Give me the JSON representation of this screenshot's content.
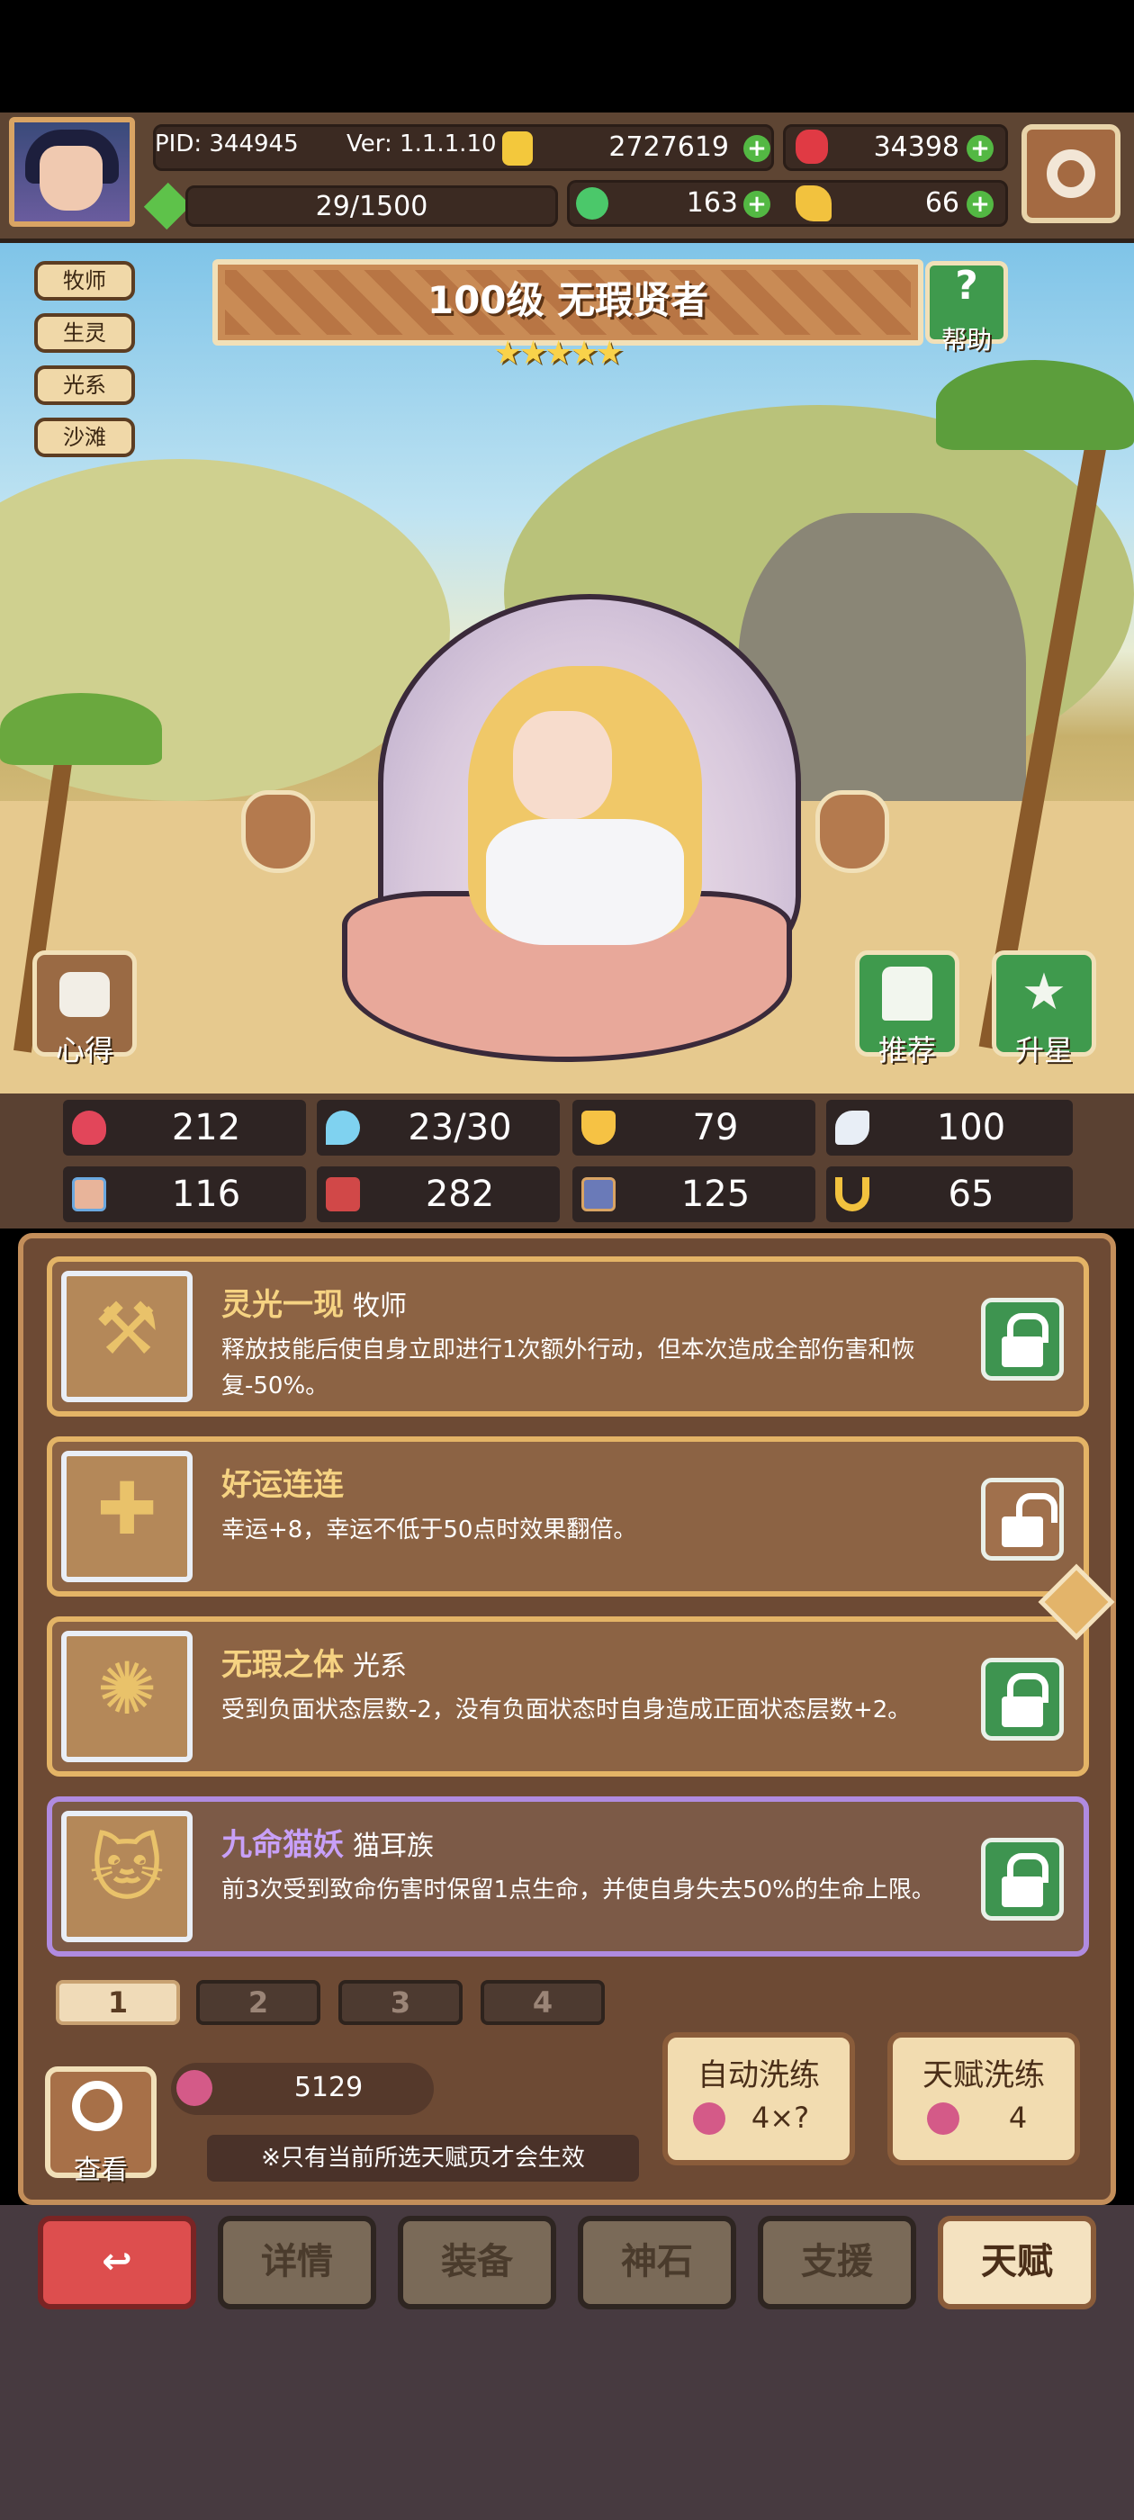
{
  "header": {
    "pid": "PID: 344945",
    "ver": "Ver: 1.1.1.10",
    "gold": "2727619",
    "ruby": "34398",
    "energy": "29/1500",
    "clover": "163",
    "bread": "66"
  },
  "hero": {
    "level_title": "100级 无瑕贤者",
    "stars": "★★★★★",
    "tags": [
      "牧师",
      "生灵",
      "光系",
      "沙滩"
    ],
    "help_label": "帮助",
    "left_btn_label": "心得",
    "recommend_label": "推荐",
    "upstar_label": "升星"
  },
  "stats": [
    {
      "icon": "heart-icon",
      "value": "212",
      "color": "#e2465a"
    },
    {
      "icon": "mana-icon",
      "value": "23/30",
      "color": "#7fd2f0"
    },
    {
      "icon": "shield-icon",
      "value": "79",
      "color": "#f6c244"
    },
    {
      "icon": "feather-icon",
      "value": "100",
      "color": "#e8eef6"
    },
    {
      "icon": "fist-icon",
      "value": "116",
      "color": "#e8b49a"
    },
    {
      "icon": "book-icon",
      "value": "282",
      "color": "#d14848"
    },
    {
      "icon": "boot-icon",
      "value": "125",
      "color": "#6a7ab8"
    },
    {
      "icon": "horseshoe-icon",
      "value": "65",
      "color": "#f2c23e"
    }
  ],
  "talents": [
    {
      "name": "灵光一现",
      "sub": "牧师",
      "desc": "释放技能后使自身立即进行1次额外行动，但本次造成全部伤害和恢复-50%。",
      "locked": true
    },
    {
      "name": "好运连连",
      "sub": "",
      "desc": "幸运+8，幸运不低于50点时效果翻倍。",
      "locked": false
    },
    {
      "name": "无瑕之体",
      "sub": "光系",
      "desc": "受到负面状态层数-2，没有负面状态时自身造成正面状态层数+2。",
      "locked": true
    },
    {
      "name": "九命猫妖",
      "sub": "猫耳族",
      "desc": "前3次受到致命伤害时保留1点生命，并使自身失去50%的生命上限。",
      "locked": true
    }
  ],
  "pages": [
    "1",
    "2",
    "3",
    "4"
  ],
  "footer": {
    "view_label": "查看",
    "cost": "5129",
    "note": "※只有当前所选天赋页才会生效",
    "auto_label": "自动洗练",
    "auto_cost": "4×?",
    "talent_label": "天赋洗练",
    "talent_cost": "4"
  },
  "nav": [
    "详情",
    "装备",
    "神石",
    "支援",
    "天赋"
  ]
}
